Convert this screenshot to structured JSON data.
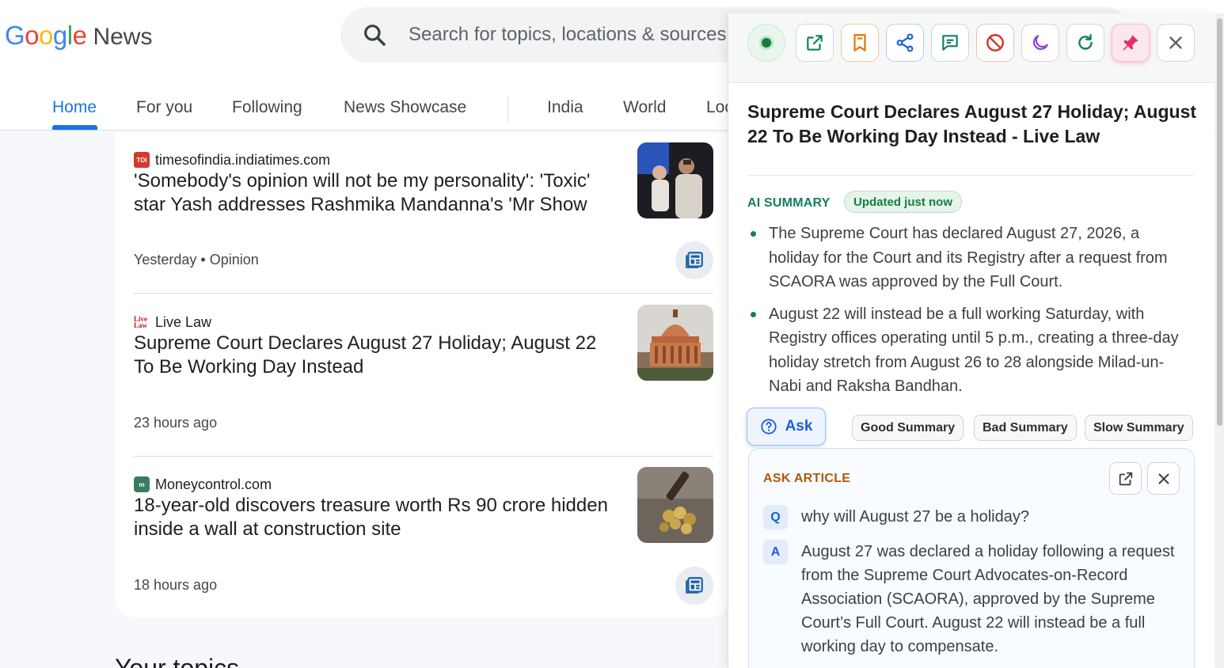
{
  "app": {
    "logo_letters": [
      {
        "char": "G",
        "color": "#4285F4"
      },
      {
        "char": "o",
        "color": "#EA4335"
      },
      {
        "char": "o",
        "color": "#FBBC05"
      },
      {
        "char": "g",
        "color": "#4285F4"
      },
      {
        "char": "l",
        "color": "#34A853"
      },
      {
        "char": "e",
        "color": "#EA4335"
      }
    ],
    "logo_suffix": "News"
  },
  "search": {
    "placeholder": "Search for topics, locations & sources",
    "icon": "search-icon"
  },
  "tabs": [
    {
      "label": "Home",
      "active": true
    },
    {
      "label": "For you",
      "active": false
    },
    {
      "label": "Following",
      "active": false
    },
    {
      "label": "News Showcase",
      "active": false
    },
    {
      "label": "India",
      "active": false
    },
    {
      "label": "World",
      "active": false
    },
    {
      "label": "Local",
      "active": false
    }
  ],
  "articles": [
    {
      "source": "timesofindia.indiatimes.com",
      "source_logo": "TOI",
      "headline": "'Somebody's opinion will not be my personality': 'Toxic' star Yash addresses Rashmika Mandanna's 'Mr Show",
      "time": "Yesterday",
      "tag": "Opinion"
    },
    {
      "source": "Live Law",
      "source_logo": "Live Law",
      "headline": "Supreme Court Declares August 27 Holiday; August 22 To Be Working Day Instead",
      "time": "23 hours ago",
      "tag": ""
    },
    {
      "source": "Moneycontrol.com",
      "source_logo": "m",
      "headline": "18-year-old discovers treasure worth Rs 90 crore hidden inside a wall at construction site",
      "time": "18 hours ago",
      "tag": ""
    }
  ],
  "section_title": "Your topics",
  "panel": {
    "toolbar_buttons": [
      {
        "name": "status-button",
        "icon": "status-dot-icon",
        "color": "#137f3c"
      },
      {
        "name": "open-external-button",
        "icon": "external-link-icon",
        "color": "#137f5e"
      },
      {
        "name": "bookmark-button",
        "icon": "bookmark-icon",
        "color": "#e37400"
      },
      {
        "name": "share-button",
        "icon": "share-icon",
        "color": "#1a5fd6"
      },
      {
        "name": "comment-button",
        "icon": "comment-icon",
        "color": "#137f5e"
      },
      {
        "name": "block-button",
        "icon": "block-icon",
        "color": "#d93025"
      },
      {
        "name": "dark-mode-button",
        "icon": "moon-icon",
        "color": "#8e44d6"
      },
      {
        "name": "refresh-button",
        "icon": "refresh-icon",
        "color": "#137f5e"
      },
      {
        "name": "pin-button",
        "icon": "pin-icon",
        "color": "#e3306c"
      },
      {
        "name": "close-panel-button",
        "icon": "close-icon",
        "color": "#5f6368"
      }
    ],
    "article_title": "Supreme Court Declares August 27 Holiday; August 22 To Be Working Day Instead - Live Law",
    "summary_label": "AI SUMMARY",
    "updated_badge": "Updated just now",
    "summary_points": [
      "The Supreme Court has declared August 27, 2026, a holiday for the Court and its Registry after a request from SCAORA was approved by the Full Court.",
      "August 22 will instead be a full working Saturday, with Registry offices operating until 5 p.m., creating a three-day holiday stretch from August 26 to 28 alongside Milad-un-Nabi and Raksha Bandhan."
    ],
    "ask_button": "Ask",
    "feedback_buttons": [
      "Good Summary",
      "Bad Summary",
      "Slow Summary"
    ],
    "ask_card": {
      "label": "ASK ARTICLE",
      "question_badge": "Q",
      "question": "why will August 27 be a holiday?",
      "answer_badge": "A",
      "answer": "August 27 was declared a holiday following a request from the Supreme Court Advocates-on-Record Association (SCAORA), approved by the Supreme Court’s Full Court. August 22 will instead be a full working day to compensate."
    }
  },
  "colors": {
    "accent": "#1a73e8",
    "summary_green": "#137f5e",
    "ask_orange": "#b05a09"
  }
}
